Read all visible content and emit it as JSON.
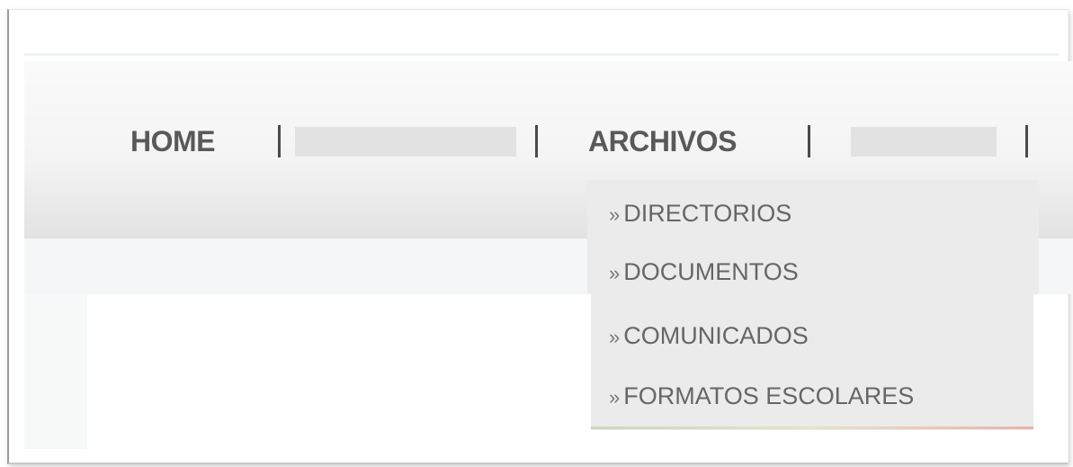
{
  "nav": {
    "home_label": "HOME",
    "archivos_label": "ARCHIVOS",
    "separator": "|"
  },
  "dropdown": {
    "bullet": "»",
    "items": [
      {
        "label": "DIRECTORIOS"
      },
      {
        "label": "DOCUMENTOS"
      },
      {
        "label": "COMUNICADOS"
      },
      {
        "label": "FORMATOS ESCOLARES"
      }
    ]
  },
  "colors": {
    "nav_text": "#595959",
    "dropdown_bg": "#ebebeb",
    "dropdown_text": "#666666"
  }
}
